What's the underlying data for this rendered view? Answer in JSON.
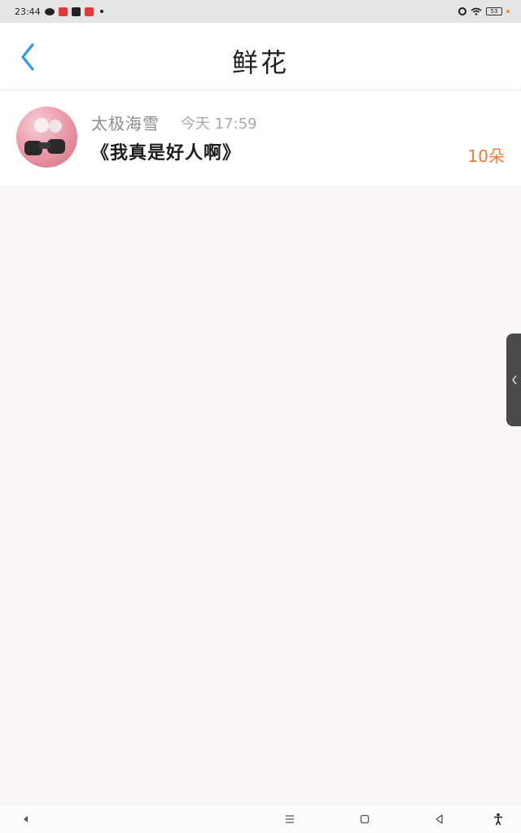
{
  "status_bar": {
    "time": "23:44",
    "battery": "53",
    "icons": [
      "wechat-icon",
      "app-red-icon",
      "app-black-icon",
      "app-red-icon",
      "dot-icon",
      "alarm-icon",
      "wifi-icon",
      "battery-icon"
    ]
  },
  "header": {
    "back_icon": "chevron-left-icon",
    "title": "鲜花",
    "accent_color": "#2b9af3"
  },
  "list": {
    "items": [
      {
        "avatar": "user-avatar",
        "username": "太极海雪",
        "time": "今天 17:59",
        "message": "《我真是好人啊》",
        "count": "10朵",
        "count_color": "#f07a35"
      }
    ]
  },
  "nav_bar": {
    "icons": [
      "back-triangle-icon",
      "menu-icon",
      "home-square-icon",
      "back-icon",
      "accessibility-icon"
    ]
  }
}
